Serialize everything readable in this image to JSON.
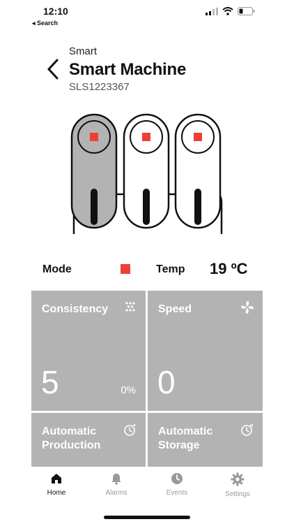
{
  "status_bar": {
    "time": "12:10",
    "back_label": "◂ Search"
  },
  "header": {
    "pretitle": "Smart",
    "title": "Smart Machine",
    "serial": "SLS1223367"
  },
  "mode_row": {
    "mode_label": "Mode",
    "mode_color": "#ef3e36",
    "temp_label": "Temp",
    "temp_value": "19 ºC"
  },
  "tiles": {
    "consistency": {
      "title": "Consistency",
      "value": "5",
      "percent": "0%",
      "icon": "dots-icon"
    },
    "speed": {
      "title": "Speed",
      "value": "0",
      "icon": "fan-icon"
    },
    "auto_production": {
      "title_line1": "Automatic",
      "title_line2": "Production",
      "icon": "alarm-clock-icon"
    },
    "auto_storage": {
      "title_line1": "Automatic",
      "title_line2": "Storage",
      "icon": "alarm-clock-icon"
    }
  },
  "tabbar": {
    "items": [
      {
        "label": "Home",
        "icon": "home-icon",
        "active": true
      },
      {
        "label": "Alarms",
        "icon": "bell-icon",
        "active": false
      },
      {
        "label": "Events",
        "icon": "clock-icon",
        "active": false
      },
      {
        "label": "Settings",
        "icon": "gear-icon",
        "active": false
      }
    ]
  },
  "colors": {
    "tile_bg": "#b3b3b3",
    "accent_red": "#ef3e36",
    "tab_inactive": "#999999"
  }
}
